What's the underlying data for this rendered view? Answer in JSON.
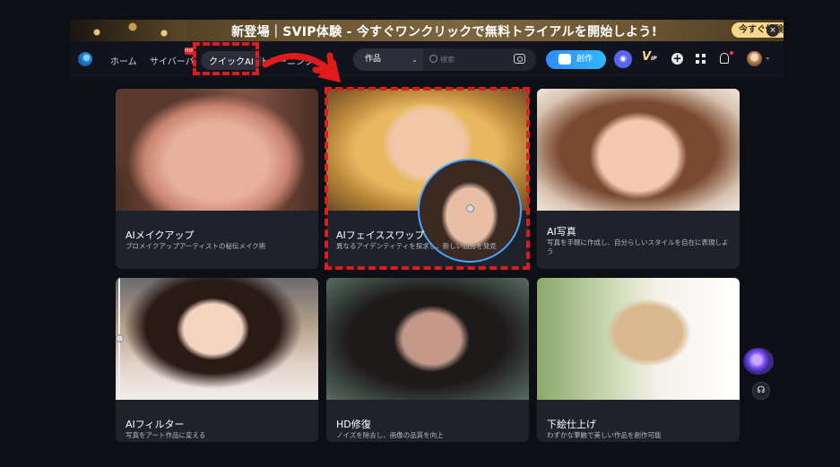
{
  "banner": {
    "text": "新登場｜SVIP体験 - 今すぐワンクリックで無料トライアルを開始しよう!",
    "cta": "今すぐ体験 »",
    "close": "×"
  },
  "nav": {
    "items": [
      "ホーム",
      "サイバーパ",
      "クイックAI",
      "トレーニング"
    ],
    "hot_badge": "Hot",
    "search_select": "作品",
    "search_placeholder": "検索",
    "create_label": "創作",
    "vip_label": "V",
    "vip_sub": "IP"
  },
  "cards": [
    {
      "title": "AIメイクアップ",
      "desc": "プロメイクアップアーティストの秘伝メイク術"
    },
    {
      "title": "AIフェイススワップ",
      "desc": "異なるアイデンティティを探求し、新しい自分を発見"
    },
    {
      "title": "AI写真",
      "desc": "写真を手軽に作成し、自分らしいスタイルを自在に表現しよう"
    },
    {
      "title": "AIフィルター",
      "desc": "写真をアート作品に変える"
    },
    {
      "title": "HD修復",
      "desc": "ノイズを除去し、画像の品質を向上"
    },
    {
      "title": "下絵仕上げ",
      "desc": "わずかな筆触で美しい作品を創作可能"
    }
  ],
  "colors": {
    "accent": "#2f8cff",
    "annotation": "#e01b1b",
    "background": "#0d0f17",
    "card": "#1f212b"
  },
  "icons": [
    "logo-icon",
    "search-icon",
    "camera-icon",
    "create-icon",
    "discord-icon",
    "vip-icon",
    "plus-icon",
    "grid-icon",
    "bell-icon",
    "avatar",
    "support-icon"
  ]
}
